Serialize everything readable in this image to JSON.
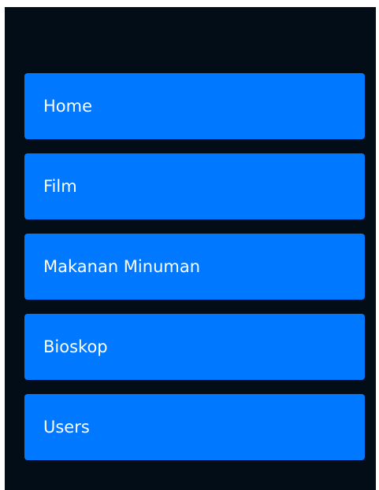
{
  "sidebar": {
    "items": [
      {
        "label": "Home"
      },
      {
        "label": "Film"
      },
      {
        "label": "Makanan Minuman"
      },
      {
        "label": "Bioskop"
      },
      {
        "label": "Users"
      }
    ]
  },
  "colors": {
    "background": "#020d18",
    "accent": "#0078ff",
    "text": "#ffffff"
  }
}
